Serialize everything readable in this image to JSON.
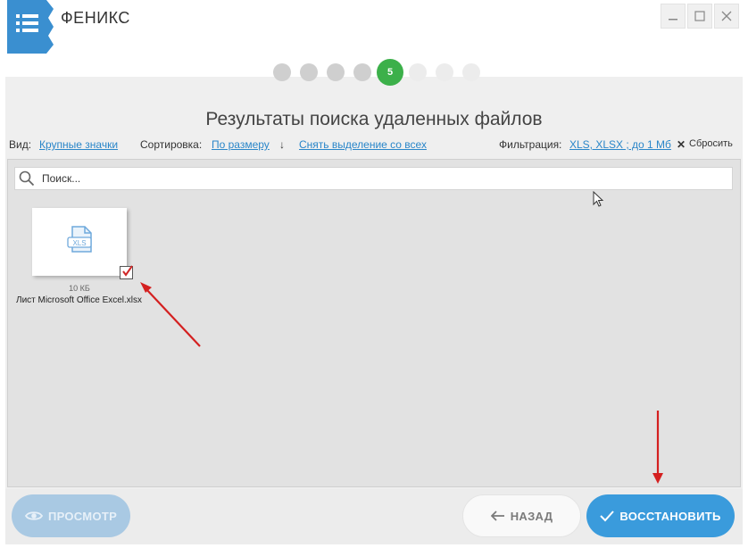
{
  "app": {
    "title": "ФЕНИКС"
  },
  "steps": {
    "total": 8,
    "current": 5,
    "current_label": "5"
  },
  "page": {
    "title": "Результаты поиска удаленных файлов"
  },
  "toolbar": {
    "view_label": "Вид:",
    "view_value": "Крупные значки",
    "sort_label": "Сортировка:",
    "sort_value": "По размеру",
    "sort_direction_glyph": "↓",
    "deselect_all": "Снять выделение со всех",
    "filter_label": "Фильтрация:",
    "filter_value": "XLS, XLSX ; до 1 Мб",
    "reset_glyph": "✕",
    "reset_label": "Сбросить"
  },
  "search": {
    "placeholder": "Поиск..."
  },
  "files": [
    {
      "type_badge": "XLS",
      "size": "10 КБ",
      "name": "Лист Microsoft Office Excel.xlsx",
      "checked": true
    }
  ],
  "footer": {
    "preview_label": "ПРОСМОТР",
    "back_label": "НАЗАД",
    "restore_label": "ВОССТАНОВИТЬ"
  },
  "colors": {
    "brand": "#3a8fd0",
    "step_active": "#3cb04a",
    "link": "#2a86c9",
    "primary_button": "#3a9bdc",
    "annotation_arrow": "#d42020"
  }
}
